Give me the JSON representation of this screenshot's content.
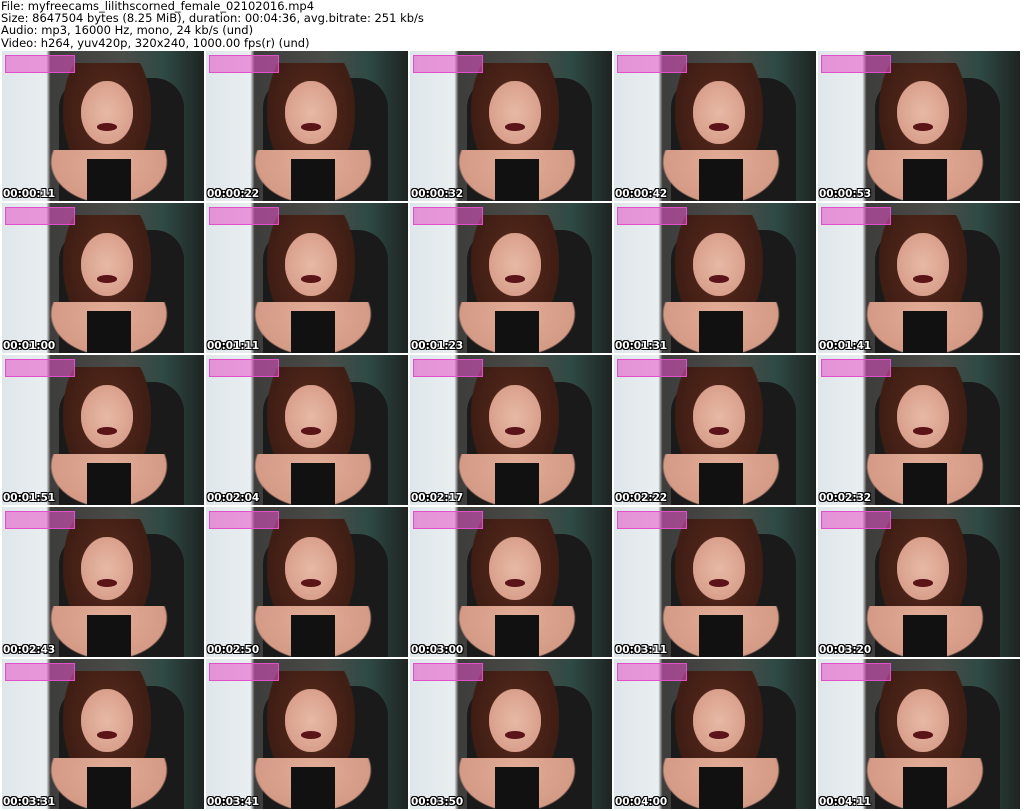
{
  "meta": {
    "file": "File: myfreecams_lilithscorned_female_02102016.mp4",
    "size": "Size: 8647504 bytes (8.25 MiB), duration: 00:04:36, avg.bitrate: 251 kb/s",
    "audio": "Audio: mp3, 16000 Hz, mono, 24 kb/s (und)",
    "video": "Video: h264, yuv420p, 320x240, 1000.00 fps(r) (und)"
  },
  "thumbnails": [
    "00:00:11",
    "00:00:22",
    "00:00:32",
    "00:00:42",
    "00:00:53",
    "00:01:00",
    "00:01:11",
    "00:01:23",
    "00:01:31",
    "00:01:41",
    "00:01:51",
    "00:02:04",
    "00:02:17",
    "00:02:22",
    "00:02:32",
    "00:02:43",
    "00:02:50",
    "00:03:00",
    "00:03:11",
    "00:03:20",
    "00:03:31",
    "00:03:41",
    "00:03:50",
    "00:04:00",
    "00:04:11"
  ]
}
